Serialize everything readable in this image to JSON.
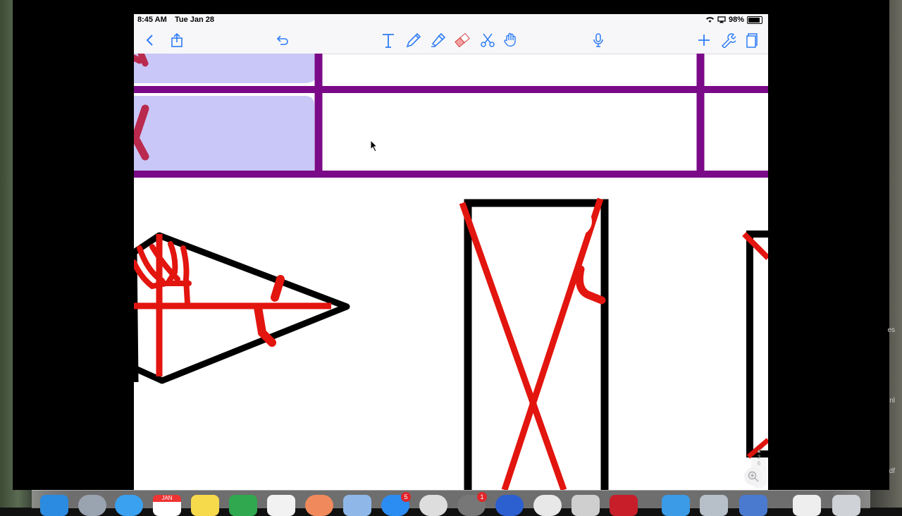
{
  "statusbar": {
    "time": "8:45 AM",
    "date": "Tue Jan 28",
    "battery": "98%"
  },
  "toolbar": {
    "left_icons": [
      "back-chevron-icon",
      "share-icon",
      "undo-icon"
    ],
    "tools": [
      "text-tool-icon",
      "pen-icon",
      "highlighter-icon",
      "eraser-icon",
      "lasso-scissors-icon",
      "shapes-hand-icon"
    ],
    "microphone": "microphone-icon",
    "right_icons": [
      "plus-icon",
      "wrench-icon",
      "pages-icon"
    ]
  },
  "page_indicator": {
    "current": "3",
    "total": "6"
  },
  "colors": {
    "ink_red": "#e2150f",
    "ink_black": "#000000",
    "ink_purple": "#7a0a88",
    "fill_lavender": "#c9c7f7",
    "ink_crimson": "#b92a4e"
  },
  "dock": {
    "calendar_month": "JAN",
    "badges": {
      "appstore": "5",
      "system": "1"
    }
  },
  "edge_text": {
    "e1": "es",
    "e2": "nl",
    "e3": "df"
  }
}
